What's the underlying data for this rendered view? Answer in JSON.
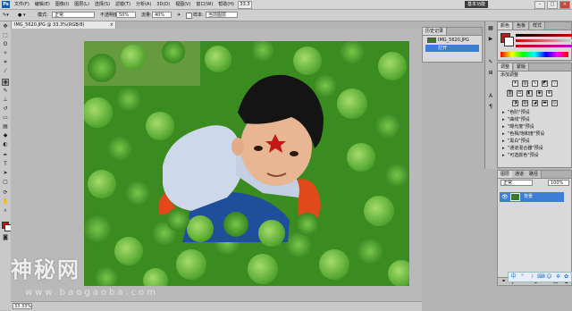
{
  "menubar": {
    "logo": "Ps",
    "menus": [
      "文件(F)",
      "编辑(E)",
      "图像(I)",
      "图层(L)",
      "选择(S)",
      "滤镜(T)",
      "分析(A)",
      "3D(D)",
      "视图(V)",
      "窗口(W)",
      "帮助(H)"
    ],
    "zoom": "33.3",
    "workspace": "基本功能"
  },
  "options": {
    "mode_label": "模式:",
    "mode_value": "正常",
    "opacity_label": "不透明度:",
    "opacity_value": "50%",
    "flow_label": "流量:",
    "flow_value": "40%",
    "sample_label": "样本:",
    "sample_value": "当前图层"
  },
  "document": {
    "tab_title": "IMG_5620.JPG @ 33.3%(RGB/8)"
  },
  "status": {
    "zoom": "33.33%"
  },
  "history_panel": {
    "tabs": [
      "历史记录"
    ],
    "items": [
      {
        "label": "IMG_5620.JPG",
        "selected": false
      },
      {
        "label": "打开",
        "selected": true
      }
    ]
  },
  "color_panel": {
    "tabs": [
      "颜色",
      "色板",
      "样式"
    ]
  },
  "adjustments_panel": {
    "tabs": [
      "调整",
      "蒙版"
    ],
    "title": "添加调整",
    "presets": [
      "\"色阶\"预设",
      "\"曲线\"预设",
      "\"曝光度\"预设",
      "\"色相/饱和度\"预设",
      "\"黑白\"预设",
      "\"通道混合器\"预设",
      "\"可选颜色\"预设"
    ]
  },
  "layers_panel": {
    "tabs": [
      "图层",
      "通道",
      "路径"
    ],
    "blend_mode": "正常",
    "opacity": "100%",
    "layer_name": "背景"
  },
  "watermark": {
    "text": "神秘网",
    "subtext": "www.baogaoba.com"
  },
  "colors": {
    "foreground": "#cc1111",
    "background": "#ffffff",
    "selection": "#3d7fd6"
  }
}
